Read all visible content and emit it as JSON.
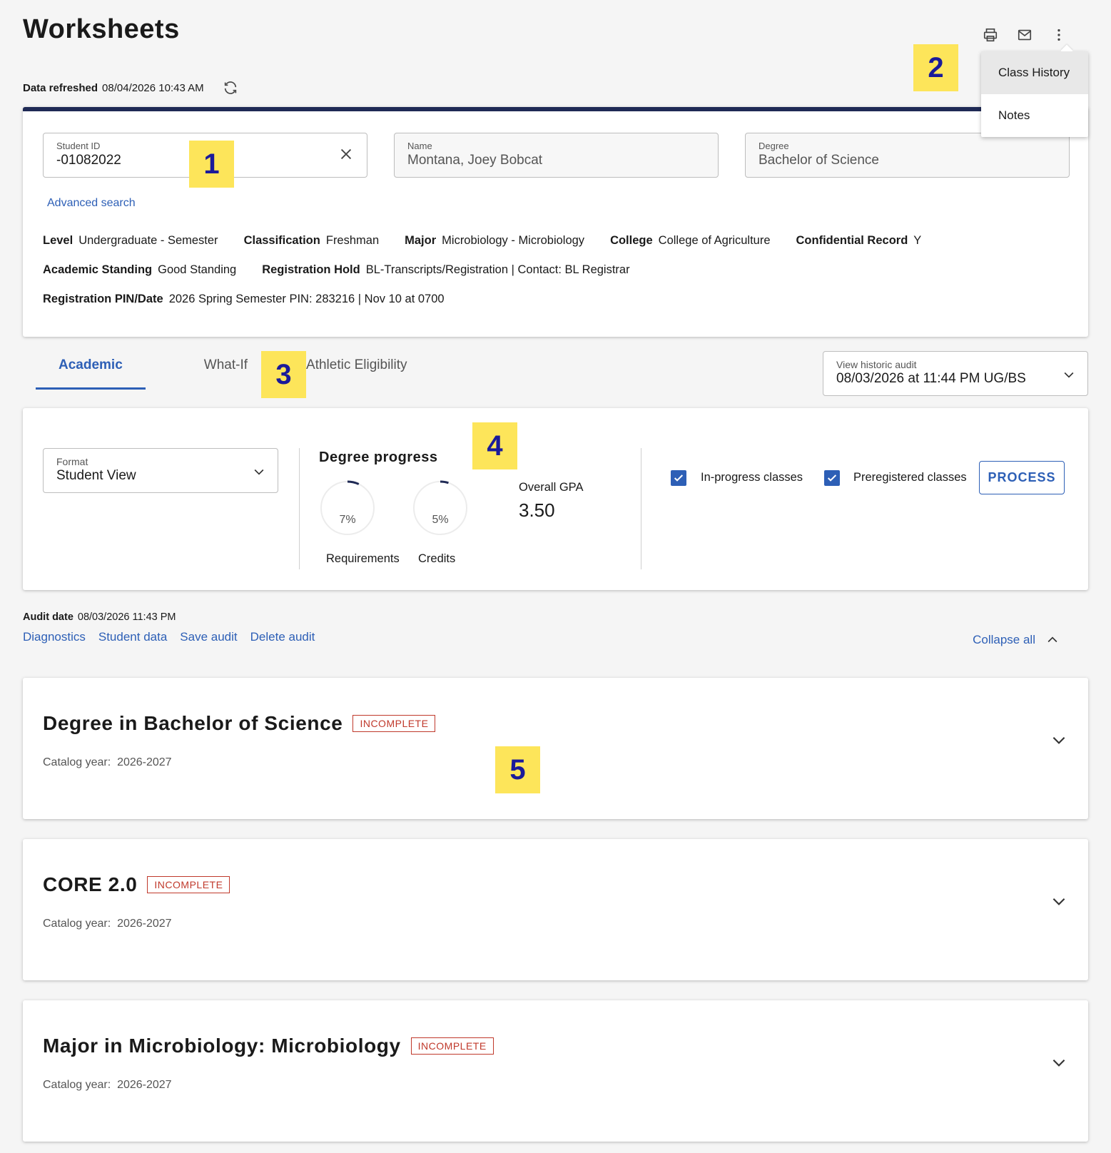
{
  "page": {
    "title": "Worksheets",
    "refreshed_label": "Data refreshed",
    "refreshed_value": "08/04/2026 10:43 AM",
    "toolbar_icons": [
      "print-icon",
      "mail-icon",
      "more-vertical-icon"
    ]
  },
  "menu": {
    "items": [
      {
        "label": "Class History"
      },
      {
        "label": "Notes"
      }
    ]
  },
  "badges": [
    "1",
    "2",
    "3",
    "4",
    "5"
  ],
  "student": {
    "id_label": "Student ID",
    "id_value": "-01082022",
    "name_label": "Name",
    "name_value": "Montana, Joey Bobcat",
    "degree_label": "Degree",
    "degree_value": "Bachelor of Science",
    "advanced_search": "Advanced search",
    "info": [
      {
        "label": "Level",
        "value": "Undergraduate - Semester"
      },
      {
        "label": "Classification",
        "value": "Freshman"
      },
      {
        "label": "Major",
        "value": "Microbiology - Microbiology"
      },
      {
        "label": "College",
        "value": "College of Agriculture"
      },
      {
        "label": "Confidential Record",
        "value": "Y"
      },
      {
        "label": "Academic Standing",
        "value": "Good Standing"
      },
      {
        "label": "Registration Hold",
        "value": "BL-Transcripts/Registration | Contact: BL Registrar"
      },
      {
        "label": "Registration PIN/Date",
        "value": "2026 Spring Semester PIN: 283216 | Nov 10 at 0700"
      }
    ]
  },
  "tabs": [
    {
      "label": "Academic"
    },
    {
      "label": "What-If"
    },
    {
      "label": "Athletic Eligibility"
    }
  ],
  "historic": {
    "label": "View historic audit",
    "value": "08/03/2026 at 11:44 PM UG/BS"
  },
  "progress": {
    "format_label": "Format",
    "format_value": "Student View",
    "title": "Degree progress",
    "requirements_pct": "7%",
    "requirements_fraction": 0.07,
    "requirements_label": "Requirements",
    "credits_pct": "5%",
    "credits_fraction": 0.05,
    "credits_label": "Credits",
    "gpa_label": "Overall GPA",
    "gpa_value": "3.50",
    "inprogress_label": "In-progress classes",
    "inprogress_checked": true,
    "preregistered_label": "Preregistered classes",
    "preregistered_checked": true,
    "process_label": "PROCESS"
  },
  "audit": {
    "date_label": "Audit date",
    "date_value": "08/03/2026 11:43 PM",
    "links": [
      "Diagnostics",
      "Student data",
      "Save audit",
      "Delete audit"
    ],
    "collapse_label": "Collapse all"
  },
  "blocks": [
    {
      "title": "Degree in Bachelor of Science",
      "status": "INCOMPLETE",
      "catalog_label": "Catalog year:",
      "catalog_value": "2026-2027"
    },
    {
      "title": "CORE 2.0",
      "status": "INCOMPLETE",
      "catalog_label": "Catalog year:",
      "catalog_value": "2026-2027"
    },
    {
      "title": "Major in Microbiology: Microbiology",
      "status": "INCOMPLETE",
      "catalog_label": "Catalog year:",
      "catalog_value": "2026-2027"
    }
  ],
  "colors": {
    "accent": "#2d5fb6",
    "header_bar": "#1f2a55",
    "incomplete": "#c0392b",
    "badge_bg": "#fde55a",
    "badge_fg": "#1a1a9a"
  }
}
